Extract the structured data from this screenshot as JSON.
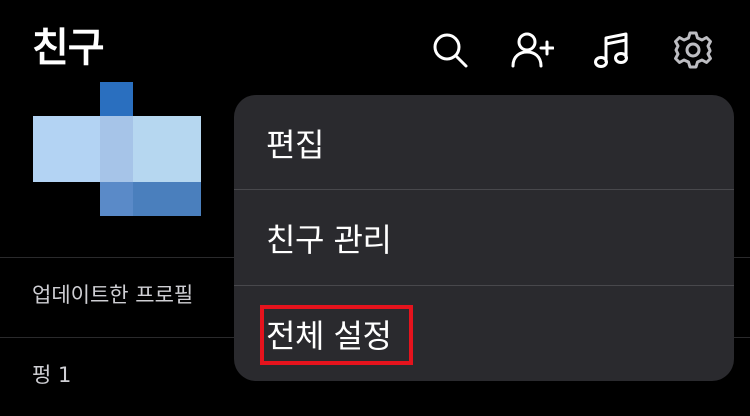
{
  "header": {
    "title": "친구",
    "icons": [
      "search-icon",
      "add-friend-icon",
      "music-icon",
      "gear-icon"
    ]
  },
  "sections": {
    "updated_profiles": "업데이트한 프로필",
    "friends_count": "펑 1"
  },
  "menu": {
    "items": [
      {
        "label": "편집"
      },
      {
        "label": "친구 관리"
      },
      {
        "label": "전체 설정"
      }
    ],
    "highlighted_index": 2
  },
  "colors": {
    "background": "#000000",
    "menu_bg": "#2a2a2e",
    "highlight": "#e5131d",
    "avatar_light": "#b3d3f3",
    "avatar_dark": "#2a6fbf"
  }
}
